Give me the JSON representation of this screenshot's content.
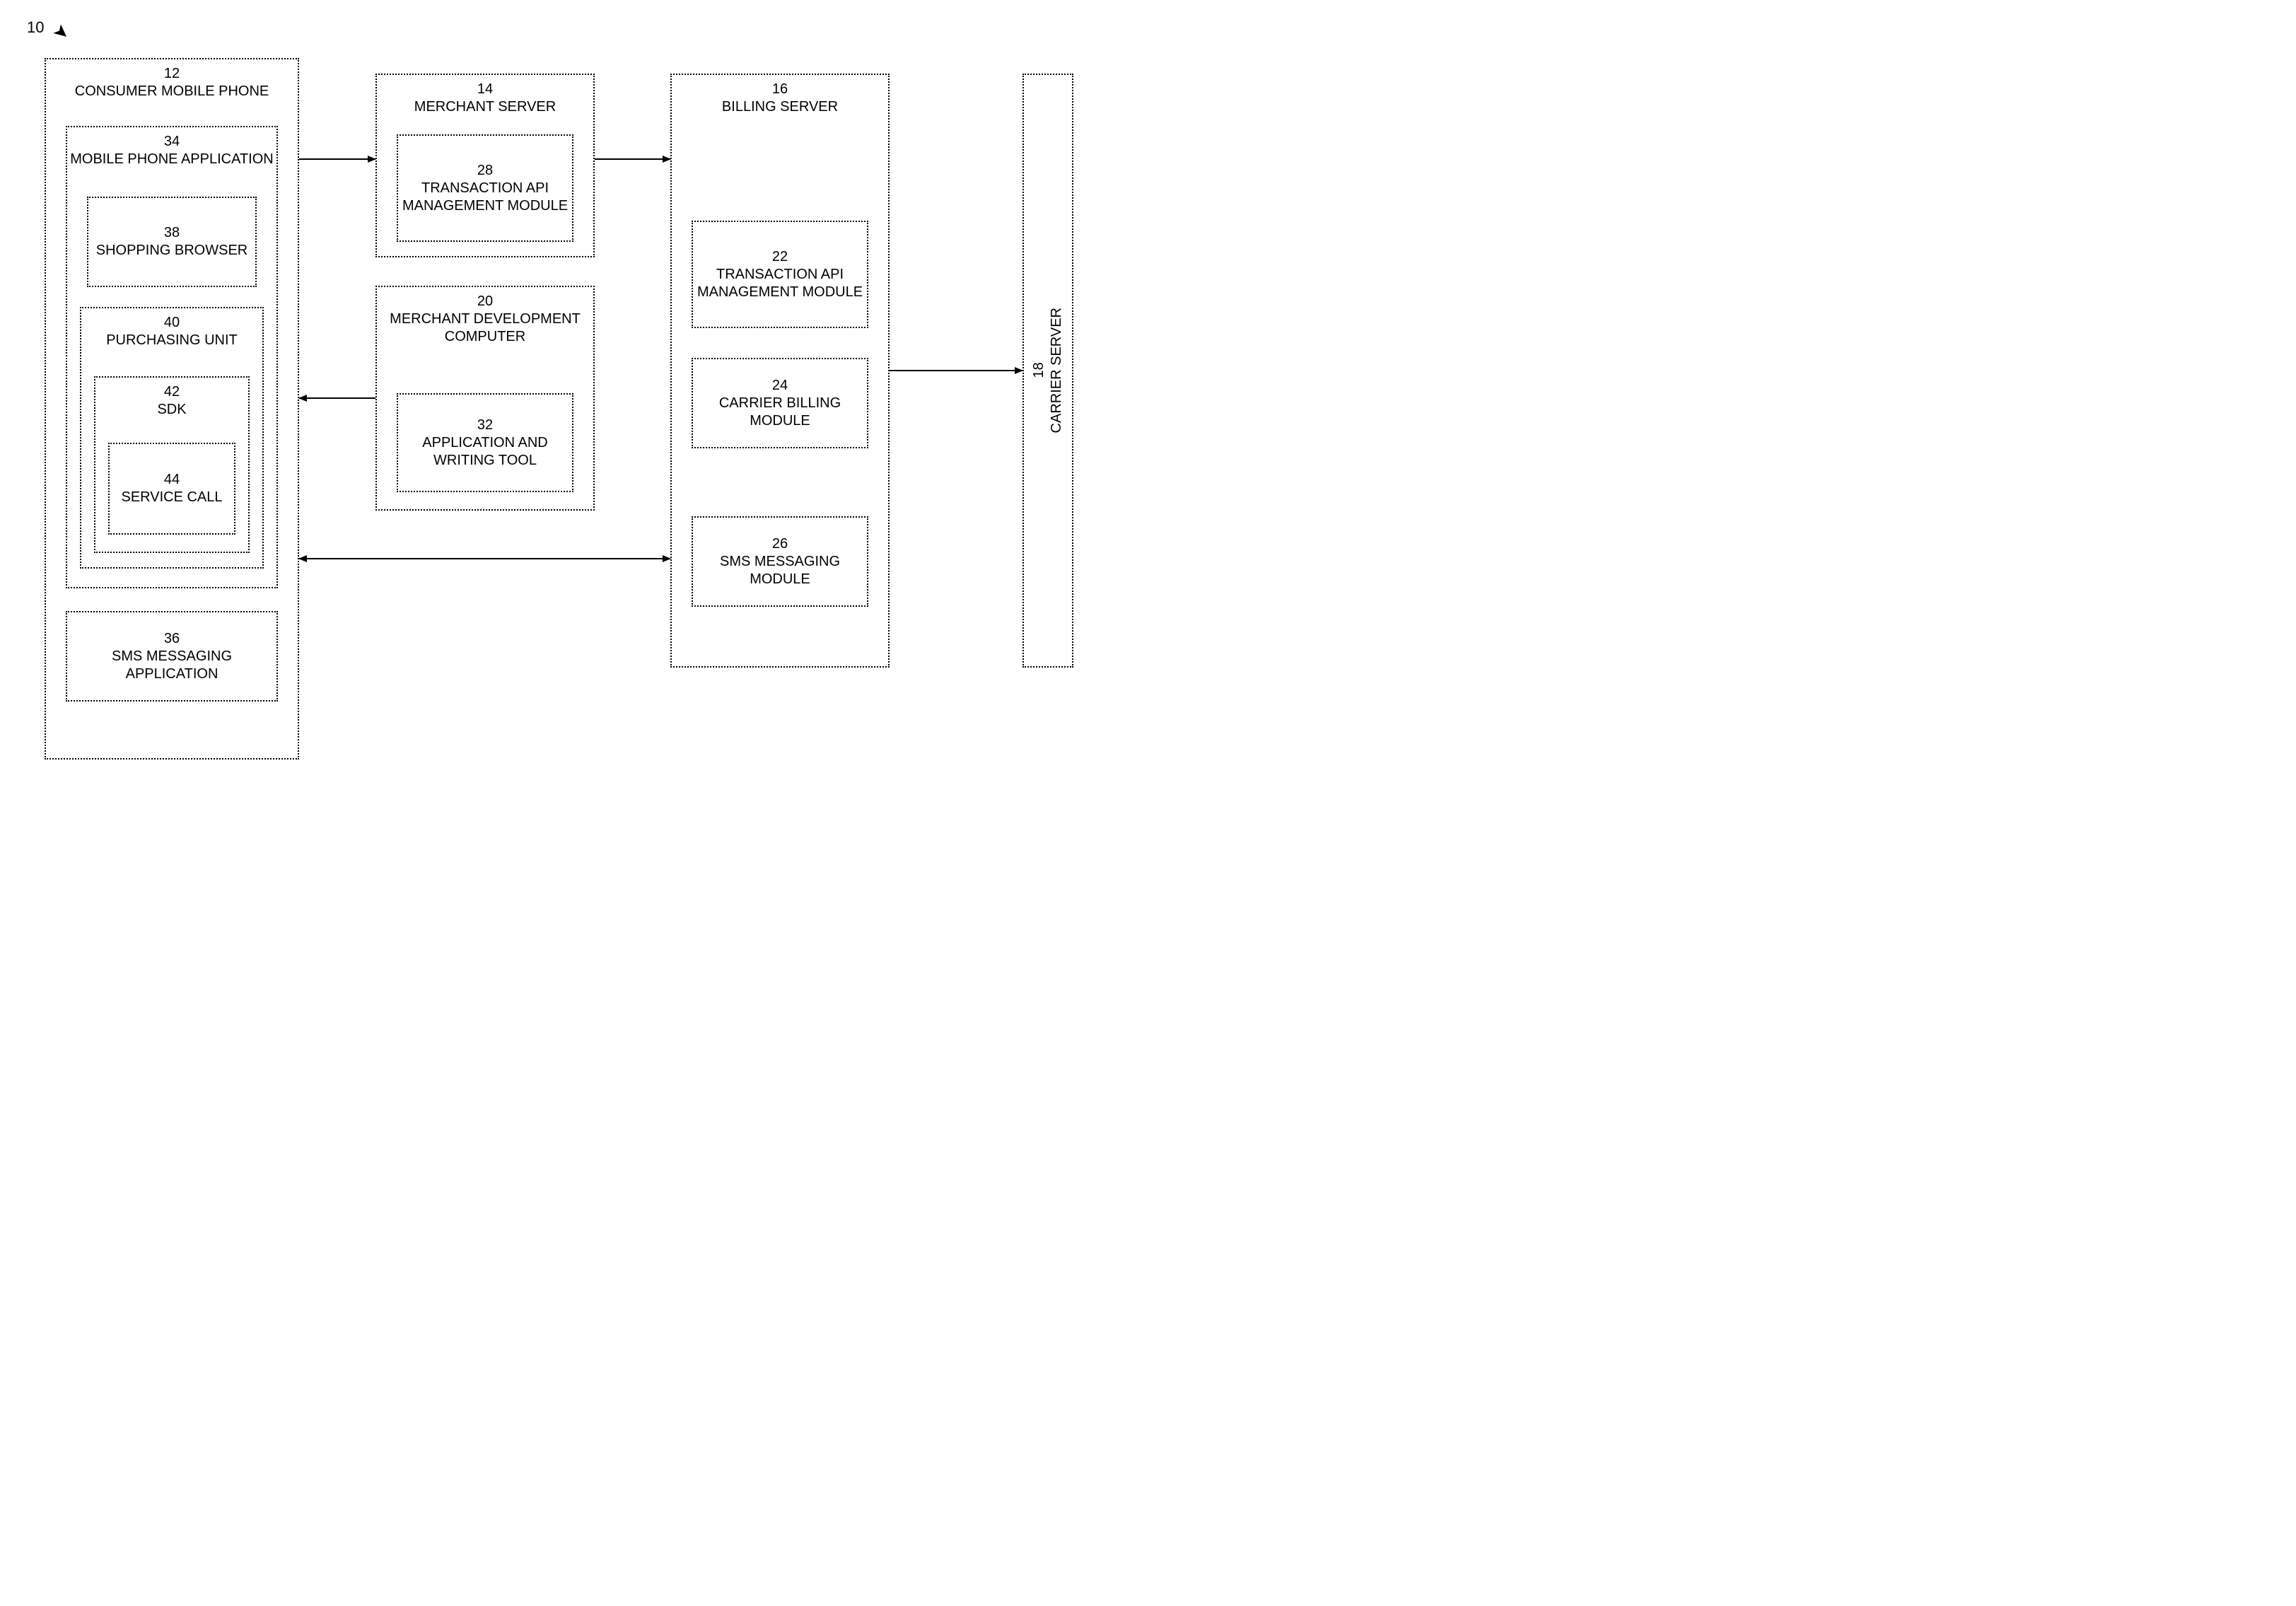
{
  "figure_ref": "10",
  "boxes": {
    "b12": {
      "num": "12",
      "label": "CONSUMER MOBILE PHONE"
    },
    "b34": {
      "num": "34",
      "label": "MOBILE PHONE APPLICATION"
    },
    "b38": {
      "num": "38",
      "label": "SHOPPING BROWSER"
    },
    "b40": {
      "num": "40",
      "label": "PURCHASING UNIT"
    },
    "b42": {
      "num": "42",
      "label": "SDK"
    },
    "b44": {
      "num": "44",
      "label": "SERVICE CALL"
    },
    "b36": {
      "num": "36",
      "label": "SMS MESSAGING APPLICATION"
    },
    "b14": {
      "num": "14",
      "label": "MERCHANT SERVER"
    },
    "b28": {
      "num": "28",
      "label": "TRANSACTION API MANAGEMENT MODULE"
    },
    "b20": {
      "num": "20",
      "label": "MERCHANT DEVELOPMENT COMPUTER"
    },
    "b32": {
      "num": "32",
      "label": "APPLICATION AND WRITING TOOL"
    },
    "b16": {
      "num": "16",
      "label": "BILLING SERVER"
    },
    "b22": {
      "num": "22",
      "label": "TRANSACTION API MANAGEMENT MODULE"
    },
    "b24": {
      "num": "24",
      "label": "CARRIER BILLING MODULE"
    },
    "b26": {
      "num": "26",
      "label": "SMS MESSAGING MODULE"
    },
    "b18": {
      "num": "18",
      "label": "CARRIER SERVER"
    }
  }
}
